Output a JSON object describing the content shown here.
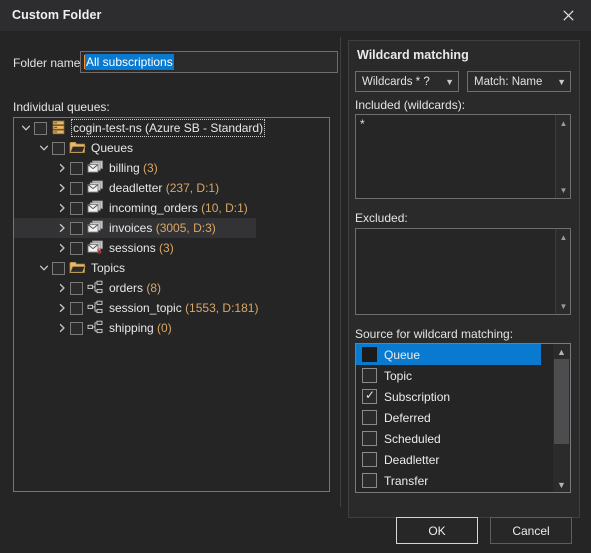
{
  "window": {
    "title": "Custom Folder",
    "close_icon": "close-icon"
  },
  "left": {
    "folder_name_label": "Folder name:",
    "folder_name_value": "All subscriptions",
    "queues_label": "Individual queues:",
    "tree": [
      {
        "label": "cogin-test-ns (Azure SB - Standard)",
        "name": "cogin-test-ns (Azure SB - Standard)",
        "count": "",
        "depth": 0,
        "icon": "server-icon",
        "expander": "chevron-down-icon",
        "focused": true,
        "hover": false
      },
      {
        "label": "Queues",
        "name": "Queues",
        "count": "",
        "depth": 1,
        "icon": "folder-icon",
        "expander": "chevron-down-icon",
        "focused": false,
        "hover": false
      },
      {
        "label": "billing (3)",
        "name": "billing",
        "count": "(3)",
        "depth": 2,
        "icon": "queue-icon",
        "expander": "chevron-right-icon",
        "focused": false,
        "hover": false
      },
      {
        "label": "deadletter (237, D:1)",
        "name": "deadletter",
        "count": "(237, D:1)",
        "depth": 2,
        "icon": "queue-icon",
        "expander": "chevron-right-icon",
        "focused": false,
        "hover": false
      },
      {
        "label": "incoming_orders (10, D:1)",
        "name": "incoming_orders",
        "count": "(10, D:1)",
        "depth": 2,
        "icon": "queue-icon",
        "expander": "chevron-right-icon",
        "focused": false,
        "hover": false
      },
      {
        "label": "invoices (3005, D:3)",
        "name": "invoices",
        "count": "(3005, D:3)",
        "depth": 2,
        "icon": "queue-icon",
        "expander": "chevron-right-icon",
        "focused": false,
        "hover": true
      },
      {
        "label": "sessions (3)",
        "name": "sessions",
        "count": "(3)",
        "depth": 2,
        "icon": "session-queue-icon",
        "expander": "chevron-right-icon",
        "focused": false,
        "hover": false
      },
      {
        "label": "Topics",
        "name": "Topics",
        "count": "",
        "depth": 1,
        "icon": "folder-icon",
        "expander": "chevron-down-icon",
        "focused": false,
        "hover": false
      },
      {
        "label": "orders (8)",
        "name": "orders",
        "count": "(8)",
        "depth": 2,
        "icon": "topic-icon",
        "expander": "chevron-right-icon",
        "focused": false,
        "hover": false
      },
      {
        "label": "session_topic (1553, D:181)",
        "name": "session_topic",
        "count": "(1553, D:181)",
        "depth": 2,
        "icon": "topic-icon",
        "expander": "chevron-right-icon",
        "focused": false,
        "hover": false
      },
      {
        "label": "shipping (0)",
        "name": "shipping",
        "count": "(0)",
        "depth": 2,
        "icon": "topic-icon",
        "expander": "chevron-right-icon",
        "focused": false,
        "hover": false
      }
    ]
  },
  "right": {
    "group_title": "Wildcard matching",
    "wildcards_combo": "Wildcards * ?",
    "match_combo": "Match: Name",
    "included_label": "Included (wildcards):",
    "included_value": "*",
    "excluded_label": "Excluded:",
    "excluded_value": "",
    "source_label": "Source for wildcard matching:",
    "source_items": [
      {
        "label": "Queue",
        "checked": false,
        "selected": true
      },
      {
        "label": "Topic",
        "checked": false,
        "selected": false
      },
      {
        "label": "Subscription",
        "checked": true,
        "selected": false
      },
      {
        "label": "Deferred",
        "checked": false,
        "selected": false
      },
      {
        "label": "Scheduled",
        "checked": false,
        "selected": false
      },
      {
        "label": "Deadletter",
        "checked": false,
        "selected": false
      },
      {
        "label": "Transfer",
        "checked": false,
        "selected": false
      }
    ]
  },
  "footer": {
    "ok_label": "OK",
    "cancel_label": "Cancel"
  },
  "colors": {
    "accent_selection": "#0a7ad1",
    "count_text": "#d9a765",
    "folder_icon": "#dfa котор",
    "window_bg": "#252526",
    "titlebar_bg": "#2d2d30"
  }
}
